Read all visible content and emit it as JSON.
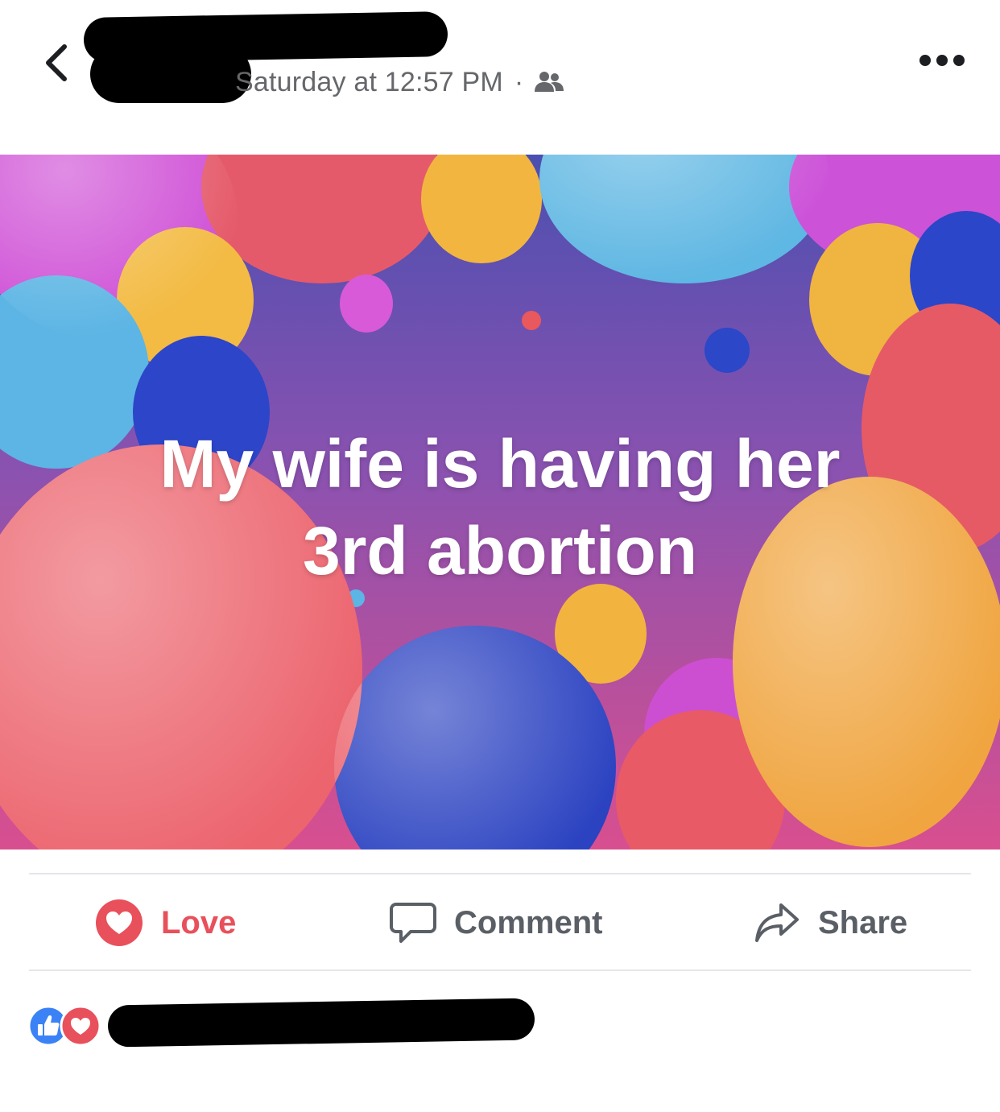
{
  "header": {
    "timestamp": "Saturday at 12:57 PM",
    "separator": "·",
    "audience_icon": "friends-icon",
    "back_icon": "chevron-left-icon",
    "more_icon": "more-horizontal-icon"
  },
  "post": {
    "text_line1": "My wife is having her",
    "text_line2": "3rd abortion"
  },
  "actions": {
    "love_label": "Love",
    "comment_label": "Comment",
    "share_label": "Share",
    "love_color": "#e8505b",
    "muted_color": "#5a5f66"
  },
  "reactions": {
    "icons": [
      "like-icon",
      "love-icon"
    ],
    "like_color": "#3b82f6",
    "love_color": "#e8505b"
  }
}
